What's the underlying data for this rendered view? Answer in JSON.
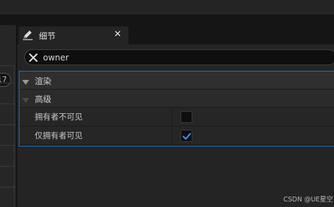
{
  "tab": {
    "title": "细节",
    "icon": "pencil-icon"
  },
  "left_panel": {
    "zoom_value": "17"
  },
  "search": {
    "value": "owner",
    "clear_icon": "close-icon"
  },
  "categories": [
    {
      "label": "渲染",
      "expanded": true
    },
    {
      "label": "高级",
      "expanded": true
    }
  ],
  "properties": [
    {
      "label": "拥有者不可见",
      "checked": false
    },
    {
      "label": "仅拥有者可见",
      "checked": true
    }
  ],
  "colors": {
    "selection_border": "#1f6fb8",
    "checkmark": "#3b8ee6"
  },
  "watermark": "CSDN @UE星空"
}
